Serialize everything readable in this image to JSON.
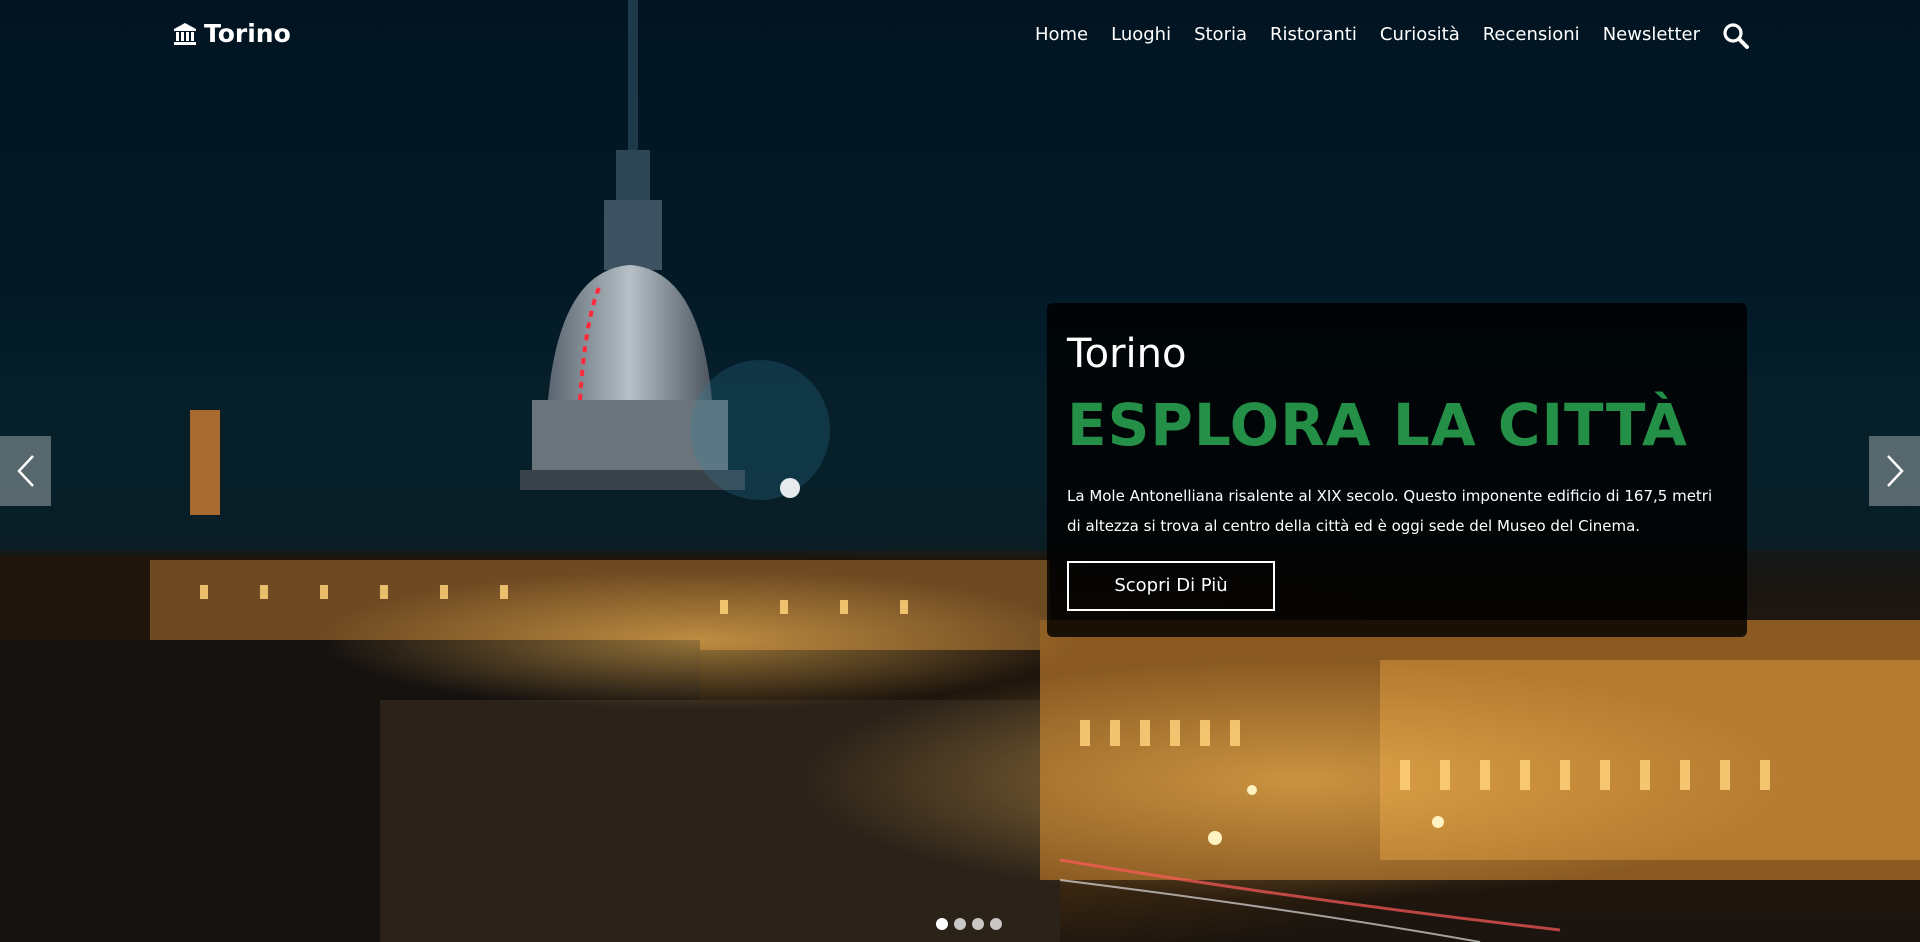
{
  "nav": {
    "brand": "Torino",
    "brand_icon": "landmark-icon",
    "links": [
      "Home",
      "Luoghi",
      "Storia",
      "Ristoranti",
      "Curiosità",
      "Recensioni",
      "Newsletter"
    ],
    "search_icon": "search-icon"
  },
  "hero": {
    "kicker": "Torino",
    "headline": "ESPLORA LA CITTÀ",
    "description": "La Mole Antonelliana risalente al XIX secolo. Questo imponente edificio di 167,5 metri di altezza si trova al centro della città ed è oggi sede del Museo del Cinema.",
    "cta_label": "Scopri Di Più",
    "accent_color": "#249047"
  },
  "carousel": {
    "slide_count": 4,
    "active_index": 0,
    "prev_icon": "chevron-left-icon",
    "next_icon": "chevron-right-icon"
  }
}
